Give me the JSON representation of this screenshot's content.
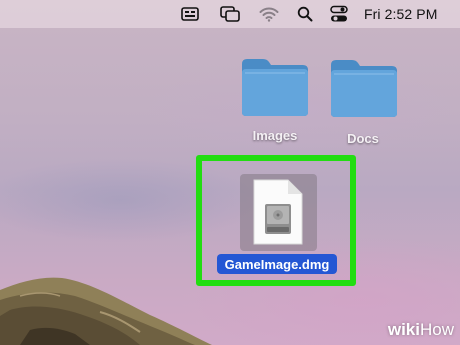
{
  "menubar": {
    "icons": [
      "keyboard-input-icon",
      "mirroring-icon",
      "wifi-icon",
      "spotlight-search-icon",
      "control-center-icon"
    ],
    "clock": "Fri 2:52 PM"
  },
  "desktop": {
    "folders": [
      {
        "label": "Images",
        "icon": "folder-icon"
      },
      {
        "label": "Docs",
        "icon": "folder-icon"
      }
    ],
    "file": {
      "label": "GameImage.dmg",
      "icon": "disk-image-icon",
      "selected": true
    },
    "highlight_color": "#22dd11",
    "selection_color": "#2457d4",
    "folder_color": "#5c9ed3"
  },
  "watermark": {
    "part1": "wiki",
    "part2": "How"
  }
}
